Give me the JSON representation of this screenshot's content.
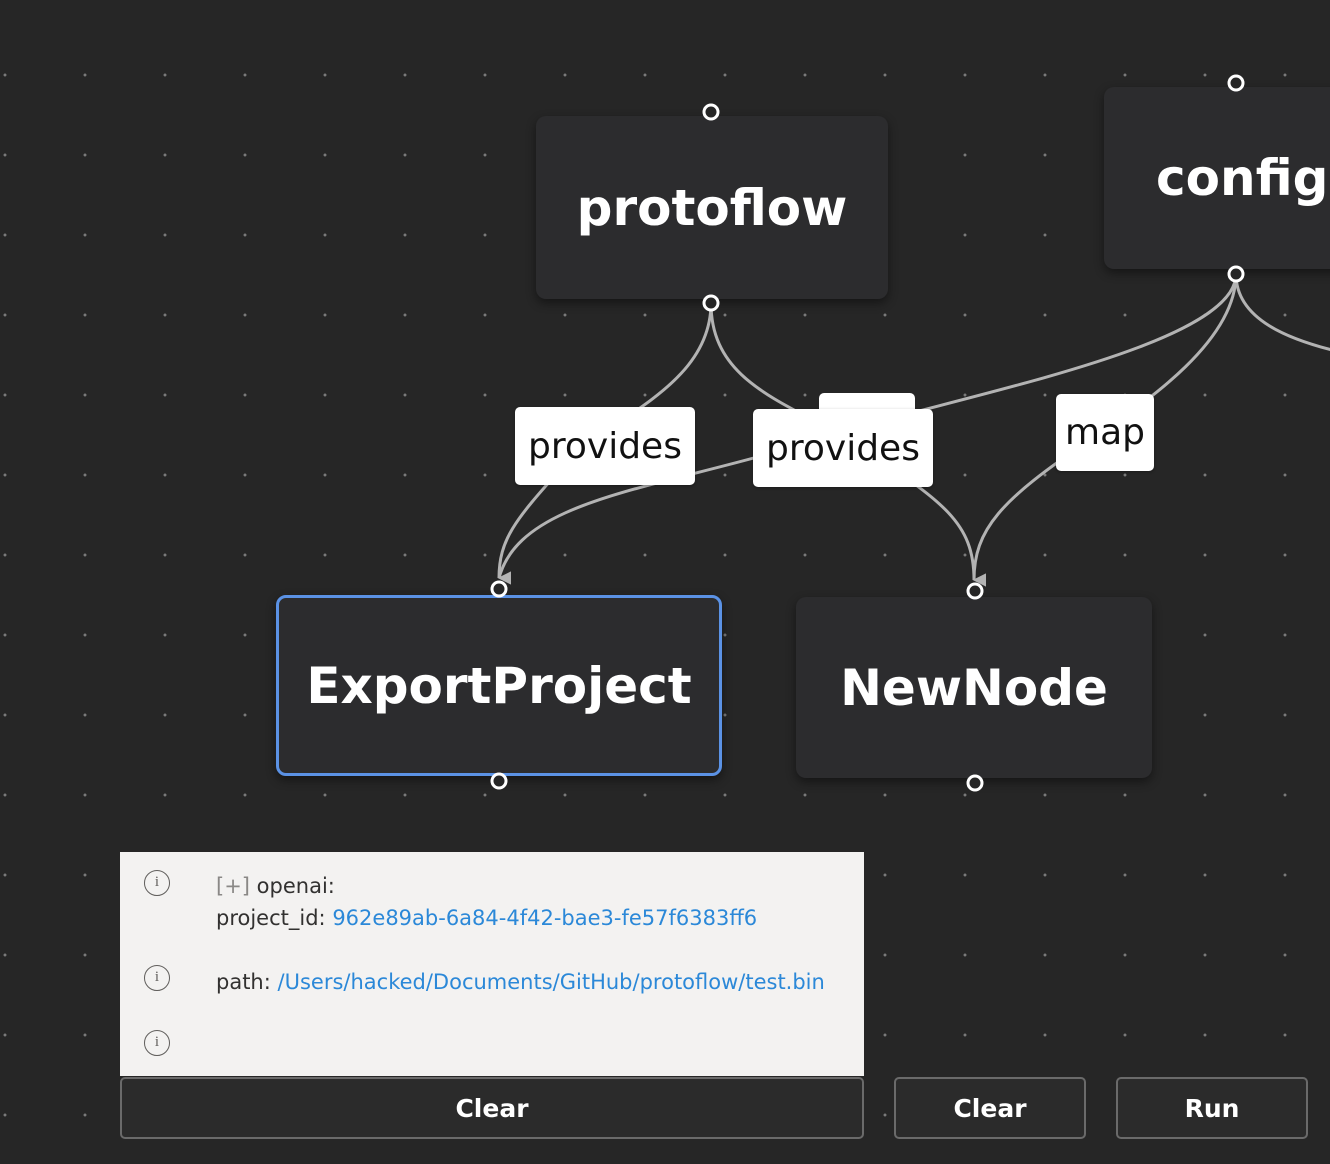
{
  "nodes": {
    "protoflow": "protoflow",
    "config": "config",
    "export_project": "ExportProject",
    "new_node": "NewNode"
  },
  "edges": {
    "provides_1": "provides",
    "provides_2": "provides",
    "map": "map"
  },
  "colors": {
    "canvas": "#262626",
    "node": "#2c2c2e",
    "selected_border": "#5b92e5",
    "edge": "#b3b3b3",
    "log_background": "#f3f2f1",
    "log_value": "#2b88d8"
  },
  "log": {
    "entries": [
      {
        "icon": "info-icon",
        "toggle": "[+]",
        "line1": "openai:",
        "key": "project_id:",
        "value": "962e89ab-6a84-4f42-bae3-fe57f6383ff6"
      },
      {
        "icon": "info-icon",
        "key": "path:",
        "value": "/Users/hacked/Documents/GitHub/protoflow/test.bin"
      },
      {
        "icon": "info-icon"
      }
    ],
    "info_glyph": "i"
  },
  "buttons": {
    "clear_log": "Clear",
    "clear": "Clear",
    "run": "Run"
  }
}
